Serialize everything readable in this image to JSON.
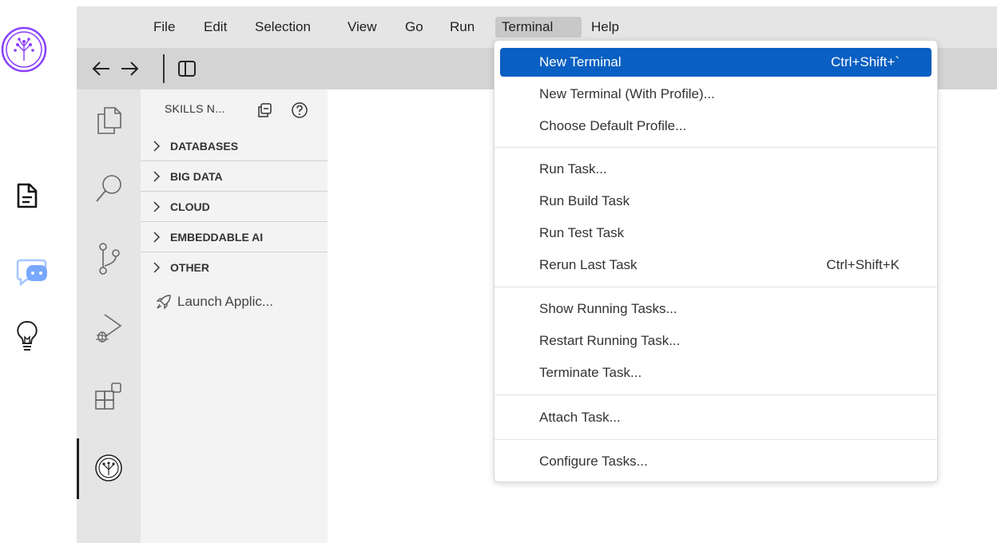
{
  "menubar": {
    "items": [
      "File",
      "Edit",
      "Selection",
      "View",
      "Go",
      "Run",
      "Terminal",
      "Help"
    ],
    "active": "Terminal"
  },
  "toolbar": {
    "back_icon": "arrow-left-icon",
    "forward_icon": "arrow-right-icon",
    "layout_icon": "panel-toggle-icon"
  },
  "outer_rail": {
    "icons": [
      "app-logo-icon",
      "document-icon",
      "chat-bot-icon",
      "lightbulb-icon"
    ],
    "accent_color": "#8a3ffc"
  },
  "activity_bar": {
    "icons": [
      "explorer-icon",
      "search-icon",
      "source-control-icon",
      "run-debug-icon",
      "extensions-icon",
      "skills-network-icon"
    ],
    "active": "skills-network-icon"
  },
  "sidebar": {
    "title": "SKILLS N...",
    "sections": [
      "DATABASES",
      "BIG DATA",
      "CLOUD",
      "EMBEDDABLE AI",
      "OTHER"
    ],
    "launch_label": "Launch Applic..."
  },
  "terminal_menu": {
    "groups": [
      [
        {
          "label": "New Terminal",
          "shortcut": "Ctrl+Shift+`"
        },
        {
          "label": "New Terminal (With Profile)...",
          "shortcut": ""
        },
        {
          "label": "Choose Default Profile...",
          "shortcut": ""
        }
      ],
      [
        {
          "label": "Run Task...",
          "shortcut": ""
        },
        {
          "label": "Run Build Task",
          "shortcut": ""
        },
        {
          "label": "Run Test Task",
          "shortcut": ""
        },
        {
          "label": "Rerun Last Task",
          "shortcut": "Ctrl+Shift+K"
        }
      ],
      [
        {
          "label": "Show Running Tasks...",
          "shortcut": ""
        },
        {
          "label": "Restart Running Task...",
          "shortcut": ""
        },
        {
          "label": "Terminate Task...",
          "shortcut": ""
        }
      ],
      [
        {
          "label": "Attach Task...",
          "shortcut": ""
        }
      ],
      [
        {
          "label": "Configure Tasks...",
          "shortcut": ""
        }
      ]
    ],
    "highlighted": "New Terminal",
    "highlight_color": "#0a5fc2"
  }
}
